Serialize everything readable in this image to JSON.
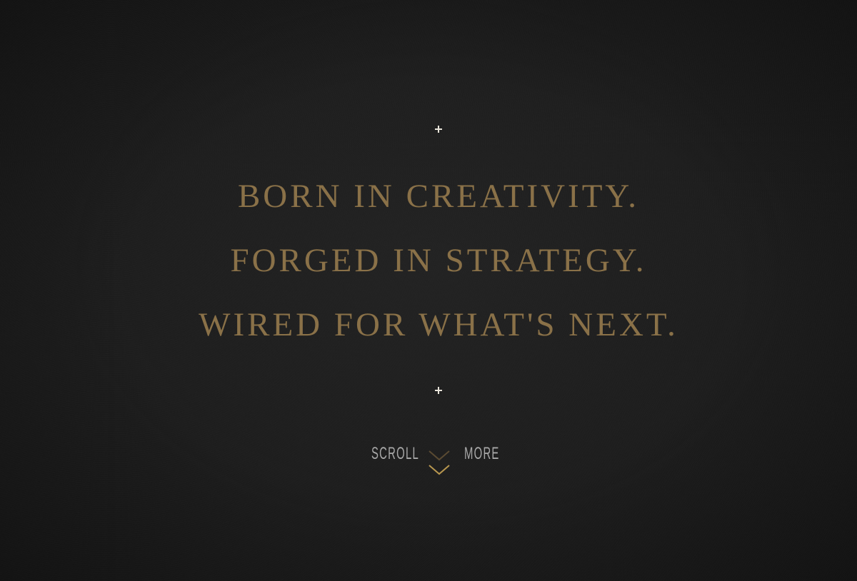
{
  "hero": {
    "lines": [
      "BORN IN CREATIVITY.",
      "FORGED IN STRATEGY.",
      "WIRED FOR WHAT'S NEXT."
    ]
  },
  "scroll_cue": {
    "left_label": "SCROLL",
    "right_label": "MORE",
    "icon": "double-chevron-down-icon"
  },
  "decor": {
    "top_mark": "plus-icon",
    "bottom_mark": "plus-icon"
  },
  "colors": {
    "background": "#1b1b1b",
    "headline_gold": "#8a7148",
    "chevron_gold": "#b8974f",
    "chevron_dim": "#5a4a32",
    "scroll_text": "#a9a9a9",
    "plus_mark": "#e8e4da"
  }
}
